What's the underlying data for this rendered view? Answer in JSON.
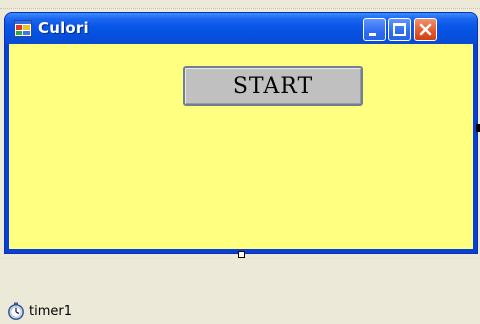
{
  "window": {
    "title": "Culori",
    "icon": "form-icon"
  },
  "titlebar_buttons": {
    "minimize": "minimize-icon",
    "maximize": "maximize-icon",
    "close": "close-icon"
  },
  "form": {
    "background_color": "#ffff80",
    "start_button_label": "START"
  },
  "component_tray": {
    "items": [
      {
        "label": "timer1",
        "icon": "timer-icon"
      }
    ]
  }
}
